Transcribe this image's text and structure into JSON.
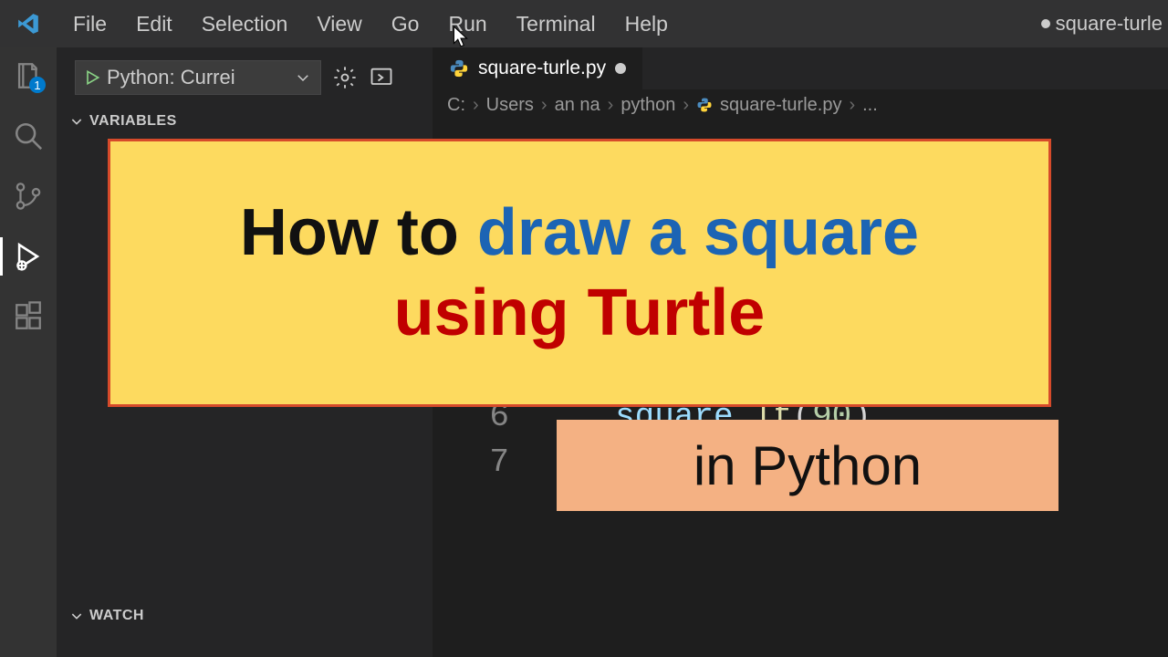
{
  "menubar": {
    "items": [
      "File",
      "Edit",
      "Selection",
      "View",
      "Go",
      "Run",
      "Terminal",
      "Help"
    ],
    "window_title": "square-turle"
  },
  "activitybar": {
    "explorer_badge": "1"
  },
  "debug": {
    "config_label": "Python: Currei",
    "sections": {
      "variables": "VARIABLES",
      "watch": "WATCH"
    }
  },
  "editor": {
    "tab": {
      "filename": "square-turle.py"
    },
    "breadcrumb": [
      "C:",
      "Users",
      "an na",
      "python",
      "square-turle.py",
      "..."
    ]
  },
  "code": {
    "line_numbers": [
      "6",
      "7"
    ],
    "line6": {
      "indent": true,
      "obj": "square",
      "dot": ".",
      "func": "lt",
      "open": "(",
      "num": "90",
      "close": ")"
    }
  },
  "overlay": {
    "line1_a": "How to ",
    "line1_b": "draw a square",
    "line2": "using Turtle",
    "banner2": "in Python"
  }
}
